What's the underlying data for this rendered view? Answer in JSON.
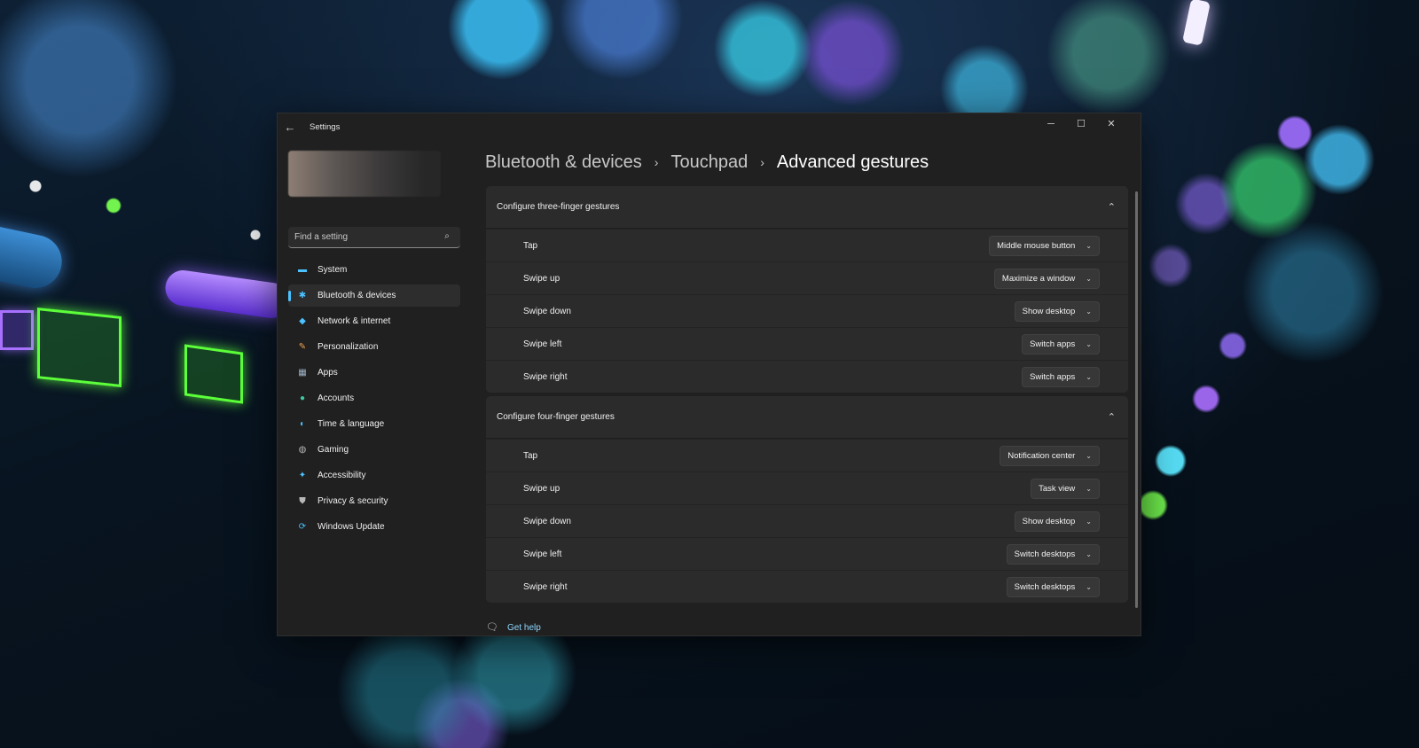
{
  "window": {
    "app_title": "Settings",
    "controls": {
      "minimize": "─",
      "maximize": "☐",
      "close": "✕"
    }
  },
  "sidebar": {
    "search_placeholder": "Find a setting",
    "items": [
      {
        "label": "System",
        "icon": "system-icon",
        "glyph": "▬",
        "color": "#4cc2ff",
        "active": false
      },
      {
        "label": "Bluetooth & devices",
        "icon": "bluetooth-icon",
        "glyph": "✱",
        "color": "#4cc2ff",
        "active": true
      },
      {
        "label": "Network & internet",
        "icon": "wifi-icon",
        "glyph": "◆",
        "color": "#4cc2ff",
        "active": false
      },
      {
        "label": "Personalization",
        "icon": "brush-icon",
        "glyph": "✎",
        "color": "#f0a050",
        "active": false
      },
      {
        "label": "Apps",
        "icon": "apps-icon",
        "glyph": "▦",
        "color": "#9fb4c8",
        "active": false
      },
      {
        "label": "Accounts",
        "icon": "accounts-icon",
        "glyph": "●",
        "color": "#3fc8a0",
        "active": false
      },
      {
        "label": "Time & language",
        "icon": "globe-icon",
        "glyph": "◐",
        "color": "#4cc2ff",
        "active": false
      },
      {
        "label": "Gaming",
        "icon": "controller-icon",
        "glyph": "◍",
        "color": "#b8b8b8",
        "active": false
      },
      {
        "label": "Accessibility",
        "icon": "accessibility-icon",
        "glyph": "✦",
        "color": "#4cc2ff",
        "active": false
      },
      {
        "label": "Privacy & security",
        "icon": "shield-icon",
        "glyph": "⛊",
        "color": "#b8b8b8",
        "active": false
      },
      {
        "label": "Windows Update",
        "icon": "update-icon",
        "glyph": "⟳",
        "color": "#4cc2ff",
        "active": false
      }
    ]
  },
  "breadcrumb": {
    "items": [
      "Bluetooth & devices",
      "Touchpad"
    ],
    "current": "Advanced gestures",
    "separator": "›"
  },
  "groups": [
    {
      "title": "Configure three-finger gestures",
      "rows": [
        {
          "label": "Tap",
          "value": "Middle mouse button"
        },
        {
          "label": "Swipe up",
          "value": "Maximize a window"
        },
        {
          "label": "Swipe down",
          "value": "Show desktop"
        },
        {
          "label": "Swipe left",
          "value": "Switch apps"
        },
        {
          "label": "Swipe right",
          "value": "Switch apps"
        }
      ]
    },
    {
      "title": "Configure four-finger gestures",
      "rows": [
        {
          "label": "Tap",
          "value": "Notification center"
        },
        {
          "label": "Swipe up",
          "value": "Task view"
        },
        {
          "label": "Swipe down",
          "value": "Show desktop"
        },
        {
          "label": "Swipe left",
          "value": "Switch desktops"
        },
        {
          "label": "Swipe right",
          "value": "Switch desktops"
        }
      ]
    }
  ],
  "help": {
    "label": "Get help"
  }
}
